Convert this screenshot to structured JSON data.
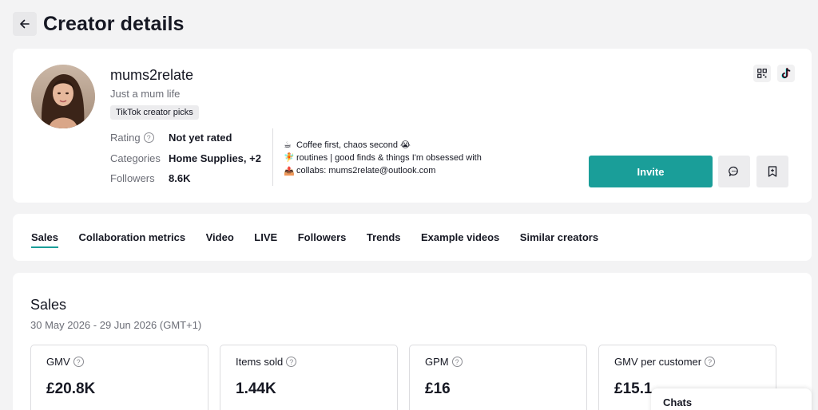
{
  "header": {
    "title": "Creator details"
  },
  "profile": {
    "username": "mums2relate",
    "bio_short": "Just a mum life",
    "tag": "TikTok creator picks",
    "stats": [
      {
        "label": "Rating",
        "value": "Not yet rated",
        "help": true
      },
      {
        "label": "Categories",
        "value": "Home Supplies, +2",
        "help": false
      },
      {
        "label": "Followers",
        "value": "8.6K",
        "help": false
      }
    ],
    "bio_lines": [
      {
        "emoji": "☕",
        "text": "Coffee first, chaos second 😭"
      },
      {
        "emoji": "🧚",
        "text": "routines | good finds & things I'm obsessed with"
      },
      {
        "emoji": "📤",
        "text": "collabs: mums2relate@outlook.com"
      }
    ],
    "invite_label": "Invite",
    "corner_icons": [
      "qr-code-icon",
      "tiktok-icon"
    ]
  },
  "tabs": [
    {
      "label": "Sales",
      "active": true
    },
    {
      "label": "Collaboration metrics"
    },
    {
      "label": "Video"
    },
    {
      "label": "LIVE"
    },
    {
      "label": "Followers"
    },
    {
      "label": "Trends"
    },
    {
      "label": "Example videos"
    },
    {
      "label": "Similar creators"
    }
  ],
  "sales": {
    "title": "Sales",
    "date_range": "30 May 2026 - 29 Jun 2026 (GMT+1)",
    "metrics": [
      {
        "label": "GMV",
        "value": "£20.8K"
      },
      {
        "label": "Items sold",
        "value": "1.44K"
      },
      {
        "label": "GPM",
        "value": "£16"
      },
      {
        "label": "GMV per customer",
        "value": "£15.1"
      }
    ]
  },
  "chats": {
    "label": "Chats"
  },
  "colors": {
    "accent": "#1a9e99",
    "background": "#f3f3f4"
  }
}
